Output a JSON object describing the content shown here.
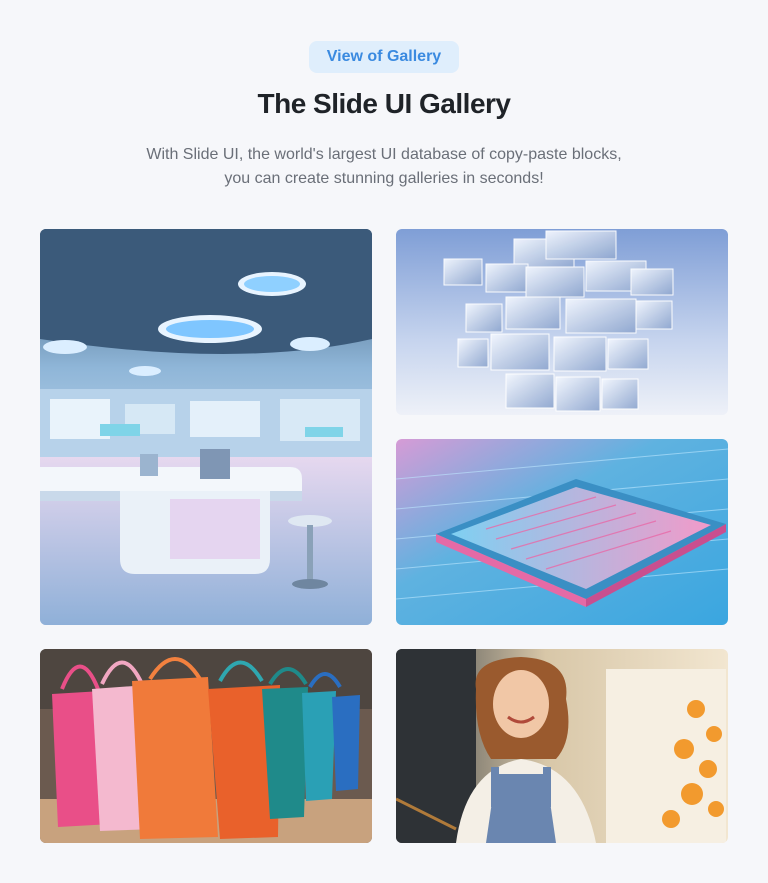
{
  "header": {
    "badge_label": "View of Gallery",
    "title": "The Slide UI Gallery",
    "subtitle_line1": "With Slide UI, the world's largest UI database of copy-paste blocks,",
    "subtitle_line2": "you can create stunning galleries in seconds!"
  },
  "gallery": {
    "items": [
      {
        "subject": "futuristic laboratory interior"
      },
      {
        "subject": "glass cubes tower"
      },
      {
        "subject": "microchip circuit board"
      },
      {
        "subject": "colorful shopping bags"
      },
      {
        "subject": "smiling woman painting"
      }
    ]
  },
  "colors": {
    "background": "#f6f7fa",
    "badge_bg": "#dfeefc",
    "badge_text": "#3a8ae0",
    "title": "#1f2328",
    "subtitle": "#6a6f78"
  }
}
